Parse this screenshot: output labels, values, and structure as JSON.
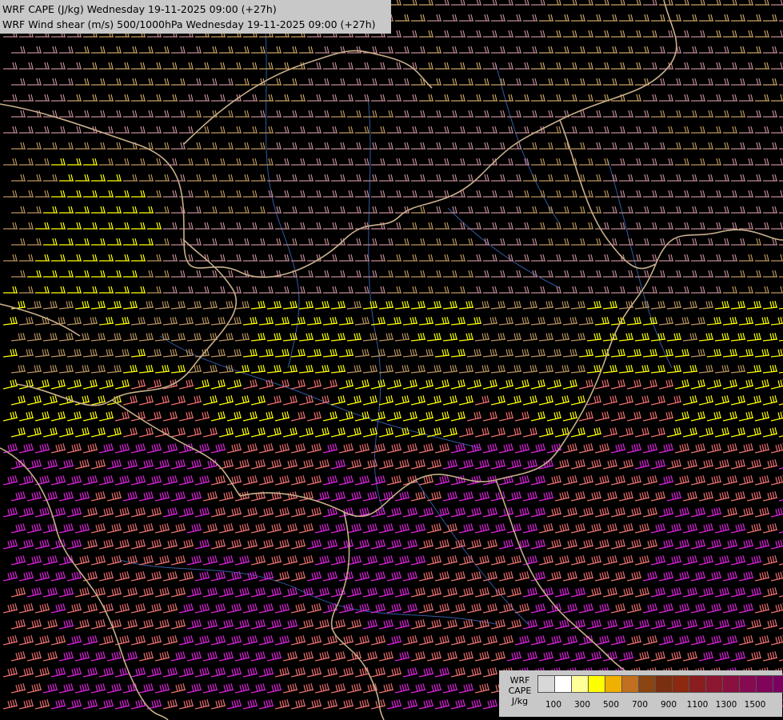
{
  "header": {
    "line1": "WRF CAPE (J/kg) Wednesday 19-11-2025 09:00 (+27h)",
    "line2": "WRF Wind shear (m/s) 500/1000hPa Wednesday 19-11-2025 09:00 (+27h)"
  },
  "legend": {
    "name_line1": "WRF",
    "name_line2": "CAPE",
    "unit": "J/kg",
    "swatches": [
      "#d8d8d8",
      "#ffffff",
      "#ffff99",
      "#ffff00",
      "#f0b000",
      "#c07020",
      "#8b4513",
      "#7a3010",
      "#8b2a10",
      "#8a1d20",
      "#8b1830",
      "#8a1040",
      "#850a50",
      "#80055a",
      "#7a0060",
      "#700060"
    ],
    "ticks": [
      "100",
      "300",
      "500",
      "700",
      "900",
      "1100",
      "1300",
      "1500"
    ]
  },
  "map": {
    "background": "#000000",
    "border_color": "#c8ae8a",
    "river_color": "#3a64b4",
    "shear_colors": [
      "#c08890",
      "#b8935a",
      "#c8a060",
      "#ffff00",
      "#f07070",
      "#e020e0"
    ]
  }
}
